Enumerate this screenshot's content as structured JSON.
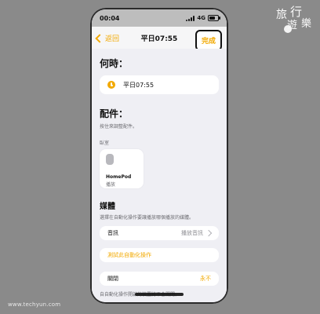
{
  "watermark": {
    "line1": "旅",
    "line2": "行",
    "line3": "遊",
    "line4": "樂"
  },
  "site": "www.techyun.com",
  "status_bar": {
    "time": "00:04",
    "network": "4G"
  },
  "nav": {
    "back_label": "返回",
    "title": "平日07:55",
    "done_label": "完成"
  },
  "when": {
    "title": "何時：",
    "time_value": "平日07:55"
  },
  "accessories": {
    "title": "配件：",
    "subtitle": "按住來調整配件。",
    "room_label": "臥室",
    "tile": {
      "name": "HomePod",
      "state": "播放"
    }
  },
  "media": {
    "title": "媒體",
    "subtitle": "選擇在自動化操作要讓播放哪個播放的媒體。",
    "row_label": "音訊",
    "row_value": "播放音訊"
  },
  "test_action_label": "測試此自動化操作",
  "close": {
    "label": "關閉",
    "value": "永不",
    "note": "自自動化操作開啟的裝置將不會關閉。"
  },
  "colors": {
    "accent": "#f2a900",
    "background": "#efeff4"
  },
  "icons": {
    "back": "chevron-left-icon",
    "clock": "clock-icon",
    "homepod": "homepod-icon",
    "row_chevron": "chevron-right-icon"
  }
}
